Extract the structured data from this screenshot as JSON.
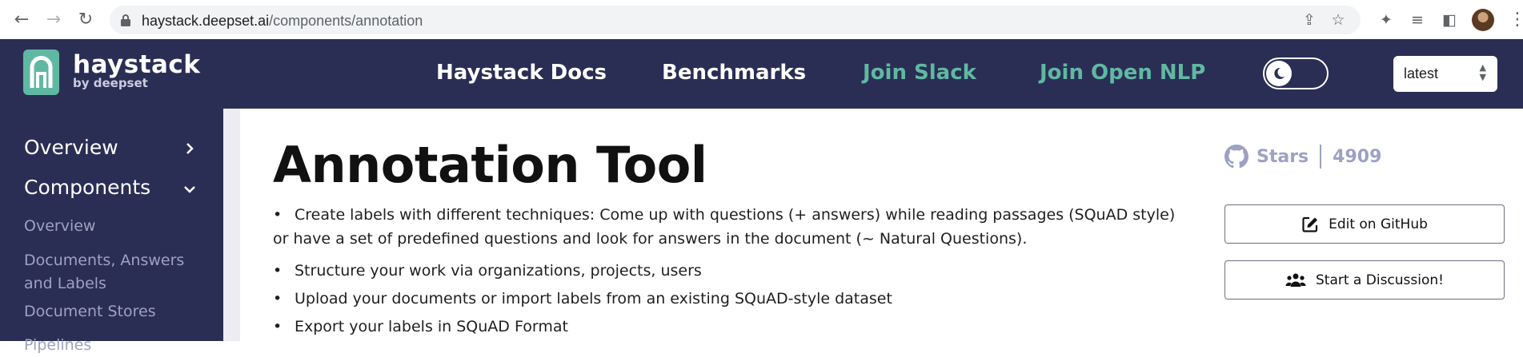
{
  "browser": {
    "url_host": "haystack.deepset.ai",
    "url_path": "/components/annotation"
  },
  "header": {
    "logo_title": "haystack",
    "logo_subtitle": "by deepset",
    "nav": [
      {
        "label": "Haystack Docs"
      },
      {
        "label": "Benchmarks"
      },
      {
        "label": "Join Slack"
      },
      {
        "label": "Join Open NLP"
      }
    ],
    "version": "latest",
    "accent_color": "#5fb9a2",
    "background_color": "#2b2e54"
  },
  "sidebar": {
    "sections": [
      {
        "label": "Overview"
      },
      {
        "label": "Components"
      }
    ],
    "sub_items": [
      {
        "label": "Overview"
      },
      {
        "label": "Documents, Answers and Labels"
      },
      {
        "label": "Document Stores"
      },
      {
        "label": "Pipelines"
      }
    ]
  },
  "main": {
    "title": "Annotation Tool",
    "bullets": [
      {
        "dot": "•",
        "text": "Create labels with different techniques: Come up with questions (+ answers) while reading passages (SQuAD style) or have a set of predefined questions and look for answers in the document (~ Natural Questions)."
      },
      {
        "dot": "•",
        "text": "Structure your work via organizations, projects, users"
      },
      {
        "dot": "•",
        "text": "Upload your documents or import labels from an existing SQuAD-style dataset"
      },
      {
        "dot": "•",
        "text": "Export your labels in SQuAD Format"
      }
    ]
  },
  "rail": {
    "stars_label": "Stars",
    "stars_count": "4909",
    "edit_label": "Edit on GitHub",
    "discussion_label": "Start a Discussion!"
  }
}
